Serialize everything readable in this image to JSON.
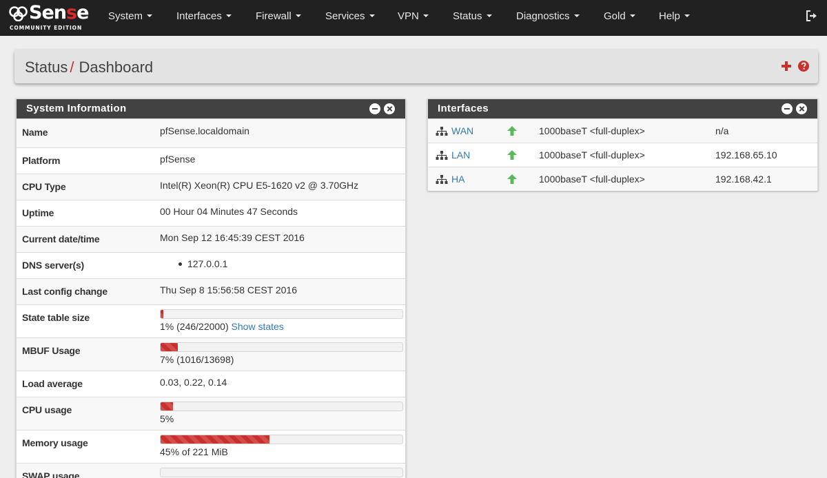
{
  "brand": {
    "name_prefix": "Sen",
    "name_highlight": "s",
    "name_suffix": "e",
    "edition": "COMMUNITY EDITION"
  },
  "nav": {
    "items": [
      {
        "label": "System"
      },
      {
        "label": "Interfaces"
      },
      {
        "label": "Firewall"
      },
      {
        "label": "Services"
      },
      {
        "label": "VPN"
      },
      {
        "label": "Status"
      },
      {
        "label": "Diagnostics"
      },
      {
        "label": "Gold"
      },
      {
        "label": "Help"
      }
    ],
    "logout_icon": "sign-out-icon"
  },
  "breadcrumb": {
    "section": "Status",
    "separator": "/",
    "page": "Dashboard",
    "add_icon": "plus-icon",
    "help_icon": "question-circle-icon"
  },
  "system_info": {
    "title": "System Information",
    "rows": {
      "name": {
        "label": "Name",
        "value": "pfSense.localdomain"
      },
      "platform": {
        "label": "Platform",
        "value": "pfSense"
      },
      "cpu_type": {
        "label": "CPU Type",
        "value": "Intel(R) Xeon(R) CPU E5-1620 v2 @ 3.70GHz"
      },
      "uptime": {
        "label": "Uptime",
        "value": "00 Hour 04 Minutes 47 Seconds"
      },
      "datetime": {
        "label": "Current date/time",
        "value": "Mon Sep 12 16:45:39 CEST 2016"
      },
      "dns": {
        "label": "DNS server(s)",
        "value": "127.0.0.1"
      },
      "last_config": {
        "label": "Last config change",
        "value": "Thu Sep 8 15:56:58 CEST 2016"
      },
      "state_table": {
        "label": "State table size",
        "percent": 1,
        "text": "1% (246/22000)",
        "link": "Show states"
      },
      "mbuf": {
        "label": "MBUF Usage",
        "percent": 7,
        "text": "7% (1016/13698)"
      },
      "load": {
        "label": "Load average",
        "value": "0.03, 0.22, 0.14"
      },
      "cpu_usage": {
        "label": "CPU usage",
        "percent": 5,
        "text": "5%"
      },
      "memory": {
        "label": "Memory usage",
        "percent": 45,
        "text": "45% of 221 MiB"
      },
      "swap": {
        "label": "SWAP usage"
      }
    }
  },
  "interfaces": {
    "title": "Interfaces",
    "rows": [
      {
        "name": "WAN",
        "status": "up",
        "media": "1000baseT <full-duplex>",
        "ip": "n/a"
      },
      {
        "name": "LAN",
        "status": "up",
        "media": "1000baseT <full-duplex>",
        "ip": "192.168.65.10"
      },
      {
        "name": "HA",
        "status": "up",
        "media": "1000baseT <full-duplex>",
        "ip": "192.168.42.1"
      }
    ]
  },
  "colors": {
    "navbar": "#212121",
    "accent": "#c9302c",
    "link": "#337ab7",
    "panel_header": "#424242",
    "status_up": "#5cb85c"
  }
}
